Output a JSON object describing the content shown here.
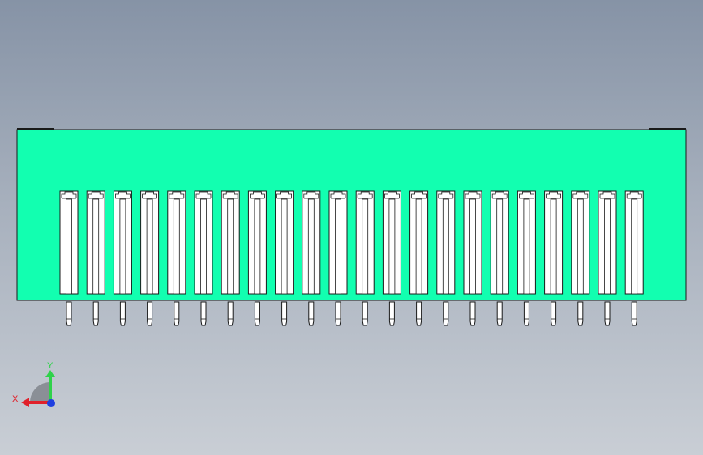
{
  "viewport": {
    "background_top": "#8693a6",
    "background_bottom": "#c9ced5"
  },
  "model": {
    "body_color": "#12ffb0",
    "edge_color": "#1a1a1a",
    "slot_fill": "#ffffff",
    "pin_fill": "#ffffff",
    "slot_count": 22,
    "pin_count": 22
  },
  "triad": {
    "x_label": "X",
    "y_label": "Y",
    "x_color": "#e0202a",
    "y_color": "#2fd24a",
    "z_color": "#1f3fe0",
    "sector_color": "#8a8f96"
  }
}
